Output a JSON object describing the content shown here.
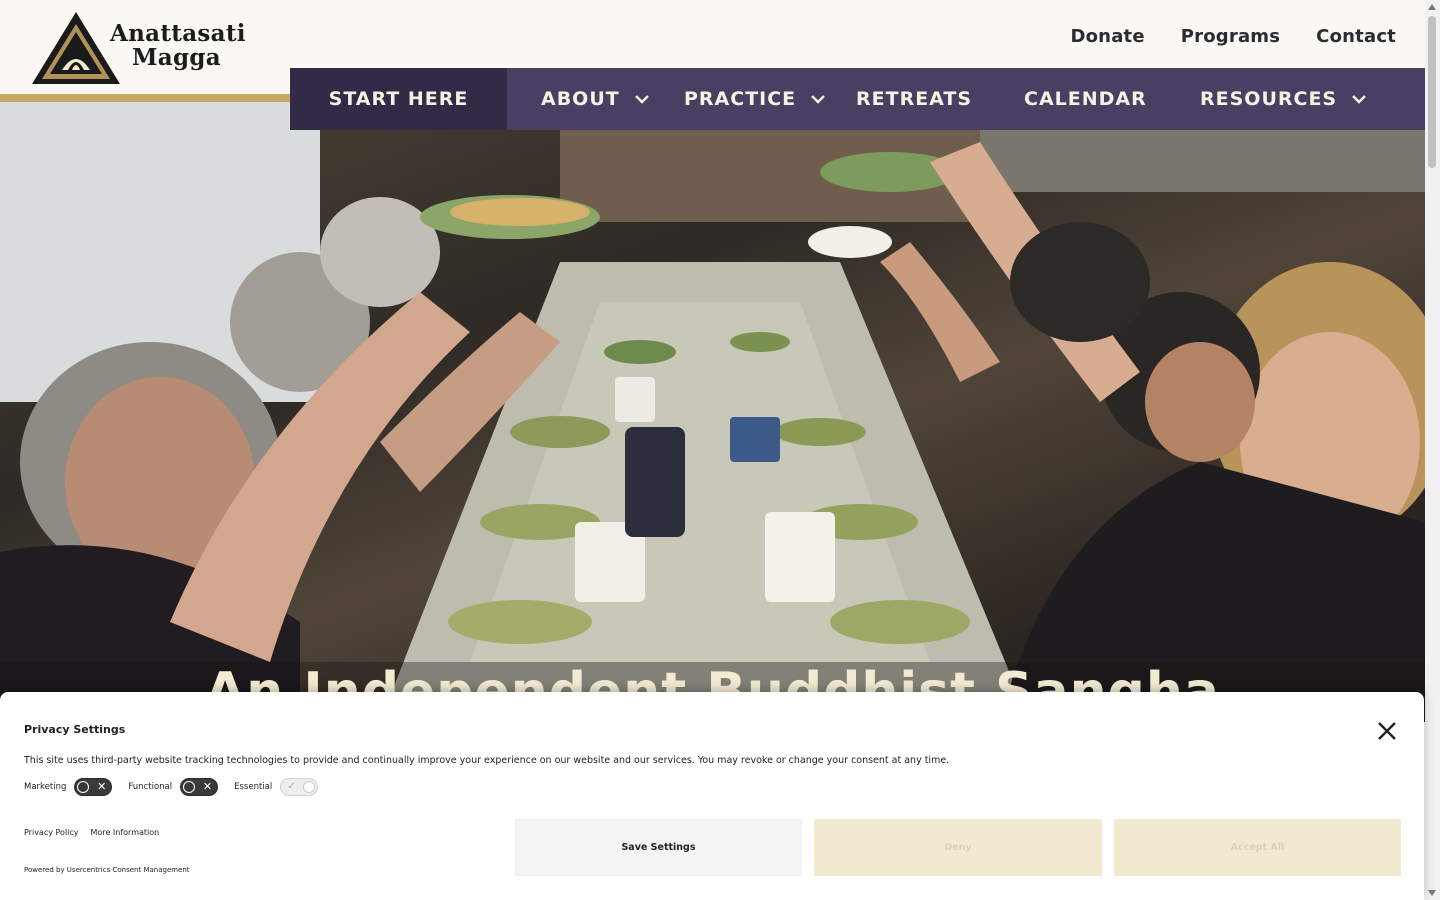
{
  "site": {
    "logo_line1": "Anattasati",
    "logo_line2": "Magga"
  },
  "utility_nav": {
    "donate": "Donate",
    "programs": "Programs",
    "contact": "Contact"
  },
  "main_nav": {
    "start_here": "START HERE",
    "about": "ABOUT",
    "practice": "PRACTICE",
    "retreats": "RETREATS",
    "calendar": "CALENDAR",
    "resources": "RESOURCES"
  },
  "hero": {
    "title": "An Independent Buddhist Sangha"
  },
  "consent": {
    "title": "Privacy Settings",
    "description": "This site uses third-party website tracking technologies to provide and continually improve your experience on our website and our services. You may revoke or change your consent at any time.",
    "toggles": {
      "marketing": "Marketing",
      "functional": "Functional",
      "essential": "Essential"
    },
    "privacy_policy": "Privacy Policy",
    "more_info": "More Information",
    "powered_by": "Powered by Usercentrics Consent Management",
    "save": "Save Settings",
    "deny": "Deny",
    "accept": "Accept All"
  },
  "colors": {
    "nav_bg": "#4a3f63",
    "nav_active_bg": "#322a47",
    "gold": "#c9a961",
    "consent_btn_bg": "#f1ead1"
  }
}
